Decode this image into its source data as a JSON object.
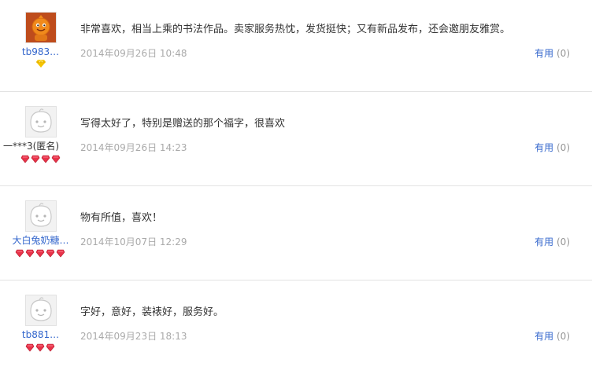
{
  "reviews": [
    {
      "username": "tb983…",
      "avatar": "orange-mascot-avatar",
      "grade_icon": "yellow-gem-icon",
      "grade_count": 1,
      "content": "非常喜欢，相当上乘的书法作品。卖家服务热忱，发货挺快；又有新品发布，还会邀朋友雅赏。",
      "date": "2014年09月26日 10:48",
      "useful_label": "有用",
      "useful_count": "(0)"
    },
    {
      "username": "一***3(匿名)",
      "avatar": "default-avatar",
      "grade_icon": "red-heart-gem-icon",
      "grade_count": 4,
      "content": "写得太好了，特别是赠送的那个福字，很喜欢",
      "date": "2014年09月26日 14:23",
      "useful_label": "有用",
      "useful_count": "(0)"
    },
    {
      "username": "大白兔奶糖…",
      "avatar": "default-avatar",
      "grade_icon": "red-heart-gem-icon",
      "grade_count": 5,
      "content": "物有所值，喜欢！",
      "date": "2014年10月07日 12:29",
      "useful_label": "有用",
      "useful_count": "(0)"
    },
    {
      "username": "tb881…",
      "avatar": "default-avatar",
      "grade_icon": "red-heart-gem-icon",
      "grade_count": 3,
      "content": "字好，意好，装裱好，服务好。",
      "date": "2014年09月23日 18:13",
      "useful_label": "有用",
      "useful_count": "(0)"
    }
  ],
  "colors": {
    "link": "#3366cc",
    "muted": "#aaaaaa",
    "text": "#333333",
    "gem_red": "#e8334a",
    "gem_yellow": "#f5c400"
  }
}
